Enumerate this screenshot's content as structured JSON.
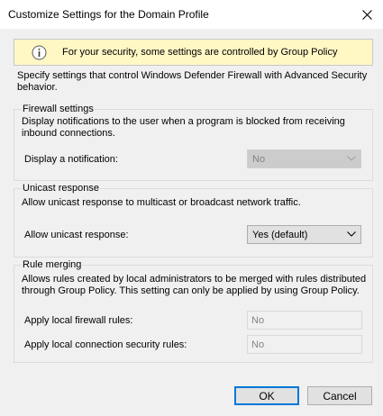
{
  "window": {
    "title": "Customize Settings for the Domain Profile"
  },
  "info_bar": {
    "text": "For your security, some settings are controlled by Group Policy",
    "icon": "info-icon"
  },
  "intro": "Specify settings that control Windows Defender Firewall with Advanced Security behavior.",
  "firewall_settings": {
    "title": "Firewall settings",
    "description": "Display notifications to the user when a program is blocked from receiving inbound connections.",
    "display_notification_label": "Display a notification:",
    "display_notification_value": "No"
  },
  "unicast_response": {
    "title": "Unicast response",
    "description": "Allow unicast response to multicast or broadcast network traffic.",
    "allow_unicast_label": "Allow unicast response:",
    "allow_unicast_value": "Yes (default)"
  },
  "rule_merging": {
    "title": "Rule merging",
    "description": "Allows rules created by local administrators to be merged with rules distributed through Group Policy. This setting can only be applied by using Group Policy.",
    "firewall_rules_label": "Apply local firewall rules:",
    "firewall_rules_value": "No",
    "connection_rules_label": "Apply local connection security rules:",
    "connection_rules_value": "No"
  },
  "buttons": {
    "ok": "OK",
    "cancel": "Cancel"
  },
  "colors": {
    "info_background": "#fff8c5",
    "dialog_background": "#f0f0f0",
    "default_button_border": "#0078d7"
  }
}
